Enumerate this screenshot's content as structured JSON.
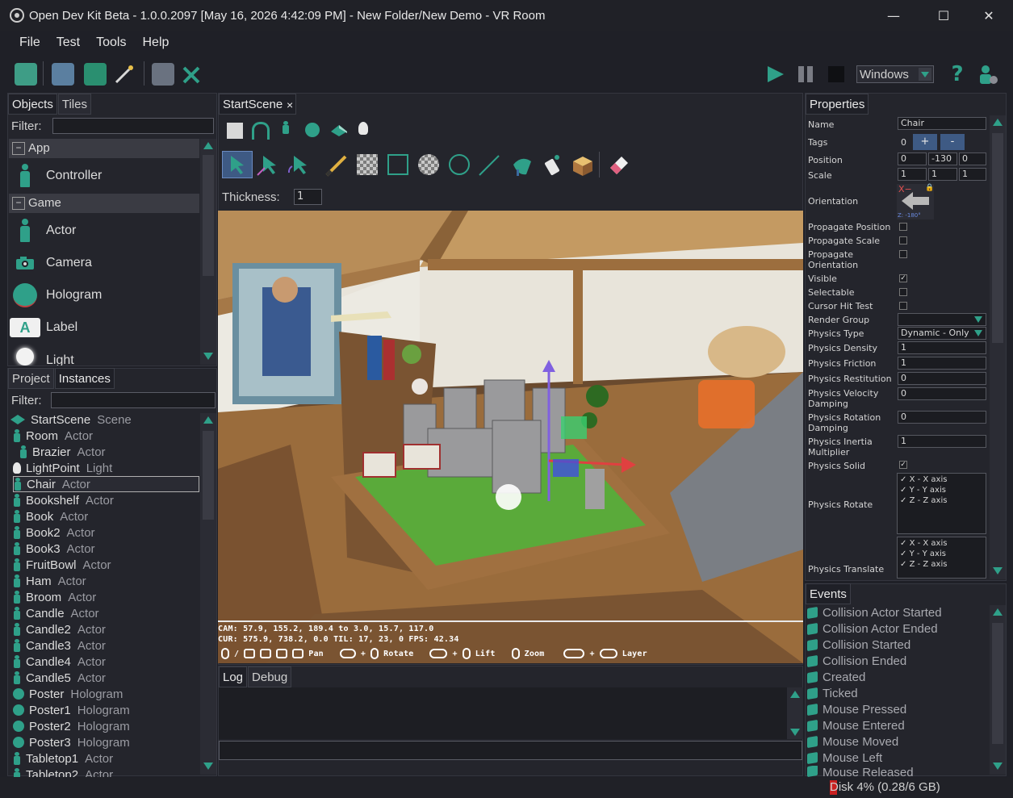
{
  "window": {
    "title": "Open Dev Kit Beta - 1.0.0.2097 [May 16, 2026 4:42:09 PM] - New Folder/New Demo - VR Room",
    "minimize": "—",
    "maximize": "☐",
    "close": "✕"
  },
  "menu": [
    "File",
    "Test",
    "Tools",
    "Help"
  ],
  "toolbar": {
    "platform": "Windows",
    "help": "?"
  },
  "objects_panel": {
    "tabs": [
      "Objects",
      "Tiles"
    ],
    "filter_label": "Filter:",
    "filter_value": "",
    "groups": [
      {
        "label": "App"
      },
      {
        "label": "Game"
      }
    ],
    "items": [
      "Controller",
      "Actor",
      "Camera",
      "Hologram",
      "Label",
      "Light"
    ],
    "label_icon": "A"
  },
  "instances_panel": {
    "tabs": [
      "Project",
      "Instances"
    ],
    "filter_label": "Filter:",
    "filter_value": "",
    "items": [
      {
        "name": "StartScene",
        "type": "Scene"
      },
      {
        "name": "Room",
        "type": "Actor"
      },
      {
        "name": "Brazier",
        "type": "Actor"
      },
      {
        "name": "LightPoint",
        "type": "Light"
      },
      {
        "name": "Chair",
        "type": "Actor"
      },
      {
        "name": "Bookshelf",
        "type": "Actor"
      },
      {
        "name": "Book",
        "type": "Actor"
      },
      {
        "name": "Book2",
        "type": "Actor"
      },
      {
        "name": "Book3",
        "type": "Actor"
      },
      {
        "name": "FruitBowl",
        "type": "Actor"
      },
      {
        "name": "Ham",
        "type": "Actor"
      },
      {
        "name": "Broom",
        "type": "Actor"
      },
      {
        "name": "Candle",
        "type": "Actor"
      },
      {
        "name": "Candle2",
        "type": "Actor"
      },
      {
        "name": "Candle3",
        "type": "Actor"
      },
      {
        "name": "Candle4",
        "type": "Actor"
      },
      {
        "name": "Candle5",
        "type": "Actor"
      },
      {
        "name": "Poster",
        "type": "Hologram"
      },
      {
        "name": "Poster1",
        "type": "Hologram"
      },
      {
        "name": "Poster2",
        "type": "Hologram"
      },
      {
        "name": "Poster3",
        "type": "Hologram"
      },
      {
        "name": "Tabletop1",
        "type": "Actor"
      },
      {
        "name": "Tabletop2",
        "type": "Actor"
      }
    ]
  },
  "scene": {
    "tab": "StartScene",
    "tab_close": "×",
    "thickness_label": "Thickness:",
    "thickness_value": "1",
    "stats": {
      "cam": "CAM: 57.9, 155.2, 189.4 to 3.0, 15.7, 117.0",
      "cur": "CUR: 575.9, 738.2, 0.0  TIL: 17, 23, 0  FPS: 42.34",
      "hint_pan": "Pan",
      "hint_rotate": "Rotate",
      "hint_lift": "Lift",
      "hint_zoom": "Zoom",
      "hint_layer": "Layer",
      "keys": [
        "+",
        "/",
        "+",
        "+"
      ]
    }
  },
  "log_panel": {
    "tabs": [
      "Log",
      "Debug"
    ]
  },
  "properties": {
    "title": "Properties",
    "name_label": "Name",
    "name_value": "Chair",
    "tags_label": "Tags",
    "tags_count": "0",
    "tags_add": "+",
    "tags_remove": "-",
    "position_label": "Position",
    "position": [
      "0",
      "-130",
      "0"
    ],
    "scale_label": "Scale",
    "scale": [
      "1",
      "1",
      "1"
    ],
    "orientation_label": "Orientation",
    "orientation_axis": "X−",
    "orientation_angle": "Z: -180°",
    "rows": [
      {
        "label": "Propagate Position",
        "type": "check",
        "checked": false
      },
      {
        "label": "Propagate Scale",
        "type": "check",
        "checked": false
      },
      {
        "label": "Propagate Orientation",
        "type": "check",
        "checked": false
      },
      {
        "label": "Visible",
        "type": "check",
        "checked": true
      },
      {
        "label": "Selectable",
        "type": "check",
        "checked": false
      },
      {
        "label": "Cursor Hit Test",
        "type": "check",
        "checked": false
      }
    ],
    "render_group_label": "Render Group",
    "render_group_value": "",
    "physics_type_label": "Physics Type",
    "physics_type_value": "Dynamic - Only",
    "physics_density_label": "Physics Density",
    "physics_density": "1",
    "physics_friction_label": "Physics Friction",
    "physics_friction": "1",
    "physics_restitution_label": "Physics Restitution",
    "physics_restitution": "0",
    "physics_velocity_label": "Physics Velocity Damping",
    "physics_velocity": "0",
    "physics_rotation_label": "Physics Rotation Damping",
    "physics_rotation": "0",
    "physics_inertia_label": "Physics Inertia Multiplier",
    "physics_inertia": "1",
    "physics_solid_label": "Physics Solid",
    "physics_solid": true,
    "physics_rotate_label": "Physics Rotate",
    "physics_rotate_axes": [
      "X - X axis",
      "Y - Y axis",
      "Z - Z axis"
    ],
    "physics_translate_label": "Physics Translate",
    "physics_translate_axes": [
      "X - X axis",
      "Y - Y axis",
      "Z - Z axis"
    ]
  },
  "events": {
    "title": "Events",
    "items": [
      "Collision Actor Started",
      "Collision Actor Ended",
      "Collision Started",
      "Collision Ended",
      "Created",
      "Ticked",
      "Mouse Pressed",
      "Mouse Entered",
      "Mouse Moved",
      "Mouse Left",
      "Mouse Released"
    ]
  },
  "status": {
    "disk": "Disk 4% (0.28/6 GB)",
    "disk_fraction": 0.04
  },
  "colors": {
    "accent": "#2fa089",
    "background": "#1f2027",
    "panel": "#24252c",
    "selection": "#b0b0b0"
  }
}
